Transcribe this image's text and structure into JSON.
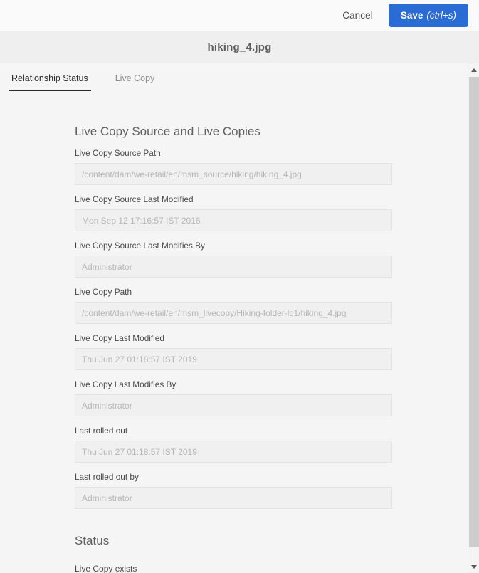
{
  "toolbar": {
    "cancel_label": "Cancel",
    "save_label": "Save",
    "save_shortcut": "(ctrl+s)",
    "save_color": "#2b6cd4"
  },
  "header": {
    "title": "hiking_4.jpg"
  },
  "tabs": [
    {
      "label": "Relationship Status",
      "active": true
    },
    {
      "label": "Live Copy",
      "active": false
    }
  ],
  "sections": {
    "live_copy": {
      "heading": "Live Copy Source and Live Copies",
      "fields": [
        {
          "label": "Live Copy Source Path",
          "value": "/content/dam/we-retail/en/msm_source/hiking/hiking_4.jpg"
        },
        {
          "label": "Live Copy Source Last Modified",
          "value": "Mon Sep 12 17:16:57 IST 2016"
        },
        {
          "label": "Live Copy Source Last Modifies By",
          "value": "Administrator"
        },
        {
          "label": "Live Copy Path",
          "value": "/content/dam/we-retail/en/msm_livecopy/Hiking-folder-lc1/hiking_4.jpg"
        },
        {
          "label": "Live Copy Last Modified",
          "value": "Thu Jun 27 01:18:57 IST 2019"
        },
        {
          "label": "Live Copy Last Modifies By",
          "value": "Administrator"
        },
        {
          "label": "Last rolled out",
          "value": "Thu Jun 27 01:18:57 IST 2019"
        },
        {
          "label": "Last rolled out by",
          "value": "Administrator"
        }
      ]
    },
    "status": {
      "heading": "Status",
      "text": "Live Copy exists"
    }
  },
  "scrollbar": {
    "up_icon": "chevron-up-icon",
    "down_icon": "chevron-down-icon"
  }
}
